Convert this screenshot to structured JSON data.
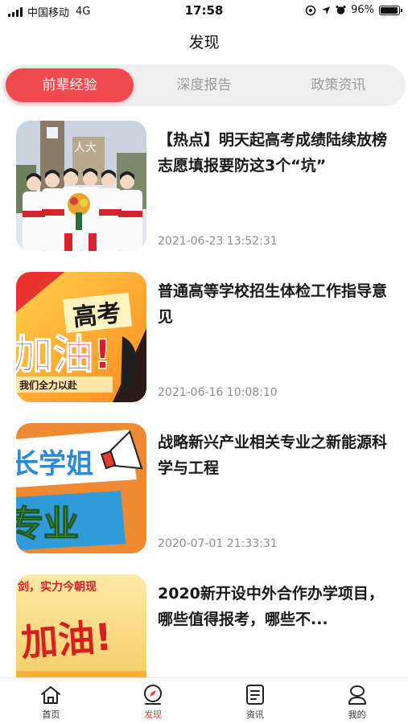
{
  "status_bar": {
    "carrier": "中国移动",
    "network": "4G",
    "time": "17:58",
    "battery": "96%",
    "battery_level": 0.96
  },
  "nav": {
    "title": "发现"
  },
  "tabs": [
    {
      "label": "前辈经验",
      "active": true
    },
    {
      "label": "深度报告",
      "active": false
    },
    {
      "label": "政策资讯",
      "active": false
    }
  ],
  "articles": [
    {
      "title": "【热点】明天起高考成绩陆续放榜 志愿填报要防这3个“坑”",
      "date": "2021-06-23 13:52:31",
      "thumb": "graduates-photo"
    },
    {
      "title": "普通高等学校招生体检工作指导意见",
      "date": "2021-06-16 10:08:10",
      "thumb_text": [
        "高考",
        "加油!",
        "我们全力以赴"
      ]
    },
    {
      "title": "战略新兴产业相关专业之新能源科学与工程",
      "date": "2020-07-01 21:33:31",
      "thumb_text": [
        "长学姐",
        "专业"
      ]
    },
    {
      "title": "2020新开设中外合作办学项目，哪些值得报考，哪些不...",
      "date": "",
      "thumb_text": [
        "剑，实力今朝现",
        "加油!"
      ]
    }
  ],
  "tabbar": [
    {
      "label": "首页",
      "icon": "home-icon",
      "active": false
    },
    {
      "label": "发现",
      "icon": "discover-icon",
      "active": true
    },
    {
      "label": "资讯",
      "icon": "news-icon",
      "active": false
    },
    {
      "label": "我的",
      "icon": "profile-icon",
      "active": false
    }
  ],
  "colors": {
    "accent": "#f04a4f",
    "tab_bg": "#efefef",
    "muted": "#8d8d8d"
  }
}
